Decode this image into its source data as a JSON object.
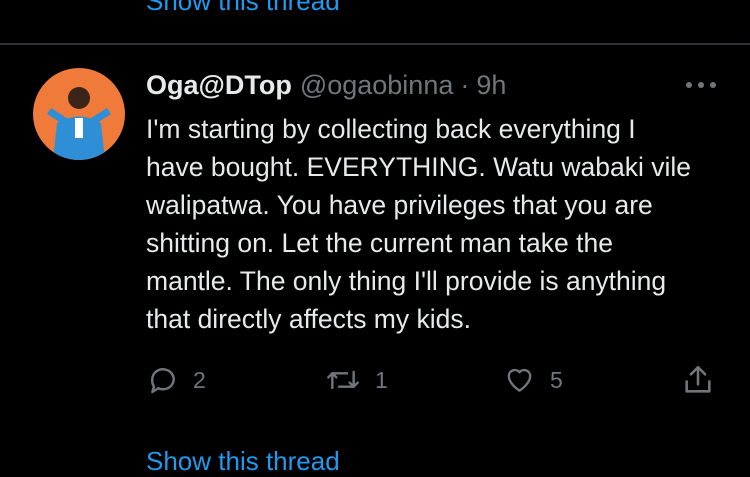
{
  "thread_link_top": "Show this thread",
  "tweet": {
    "display_name": "Oga@DTop",
    "handle": "@ogaobinna",
    "separator": "·",
    "time": "9h",
    "lines": [
      "I'm starting by collecting back everything I",
      "have bought. EVERYTHING.  Watu wabaki vile",
      "walipatwa. You have privileges that you are",
      "shitting on. Let the current man take the",
      "mantle. The only thing I'll provide is anything",
      "that directly affects my kids."
    ],
    "replies": "2",
    "retweets": "1",
    "likes": "5"
  },
  "thread_link_bottom": "Show this thread",
  "icons": {
    "more": "more-options-icon",
    "reply": "reply-icon",
    "retweet": "retweet-icon",
    "like": "heart-icon",
    "share": "share-icon"
  },
  "colors": {
    "background": "#000000",
    "text": "#e7e9ea",
    "muted": "#71767b",
    "link": "#1d9bf0",
    "avatar_bg": "#f07a3a"
  }
}
